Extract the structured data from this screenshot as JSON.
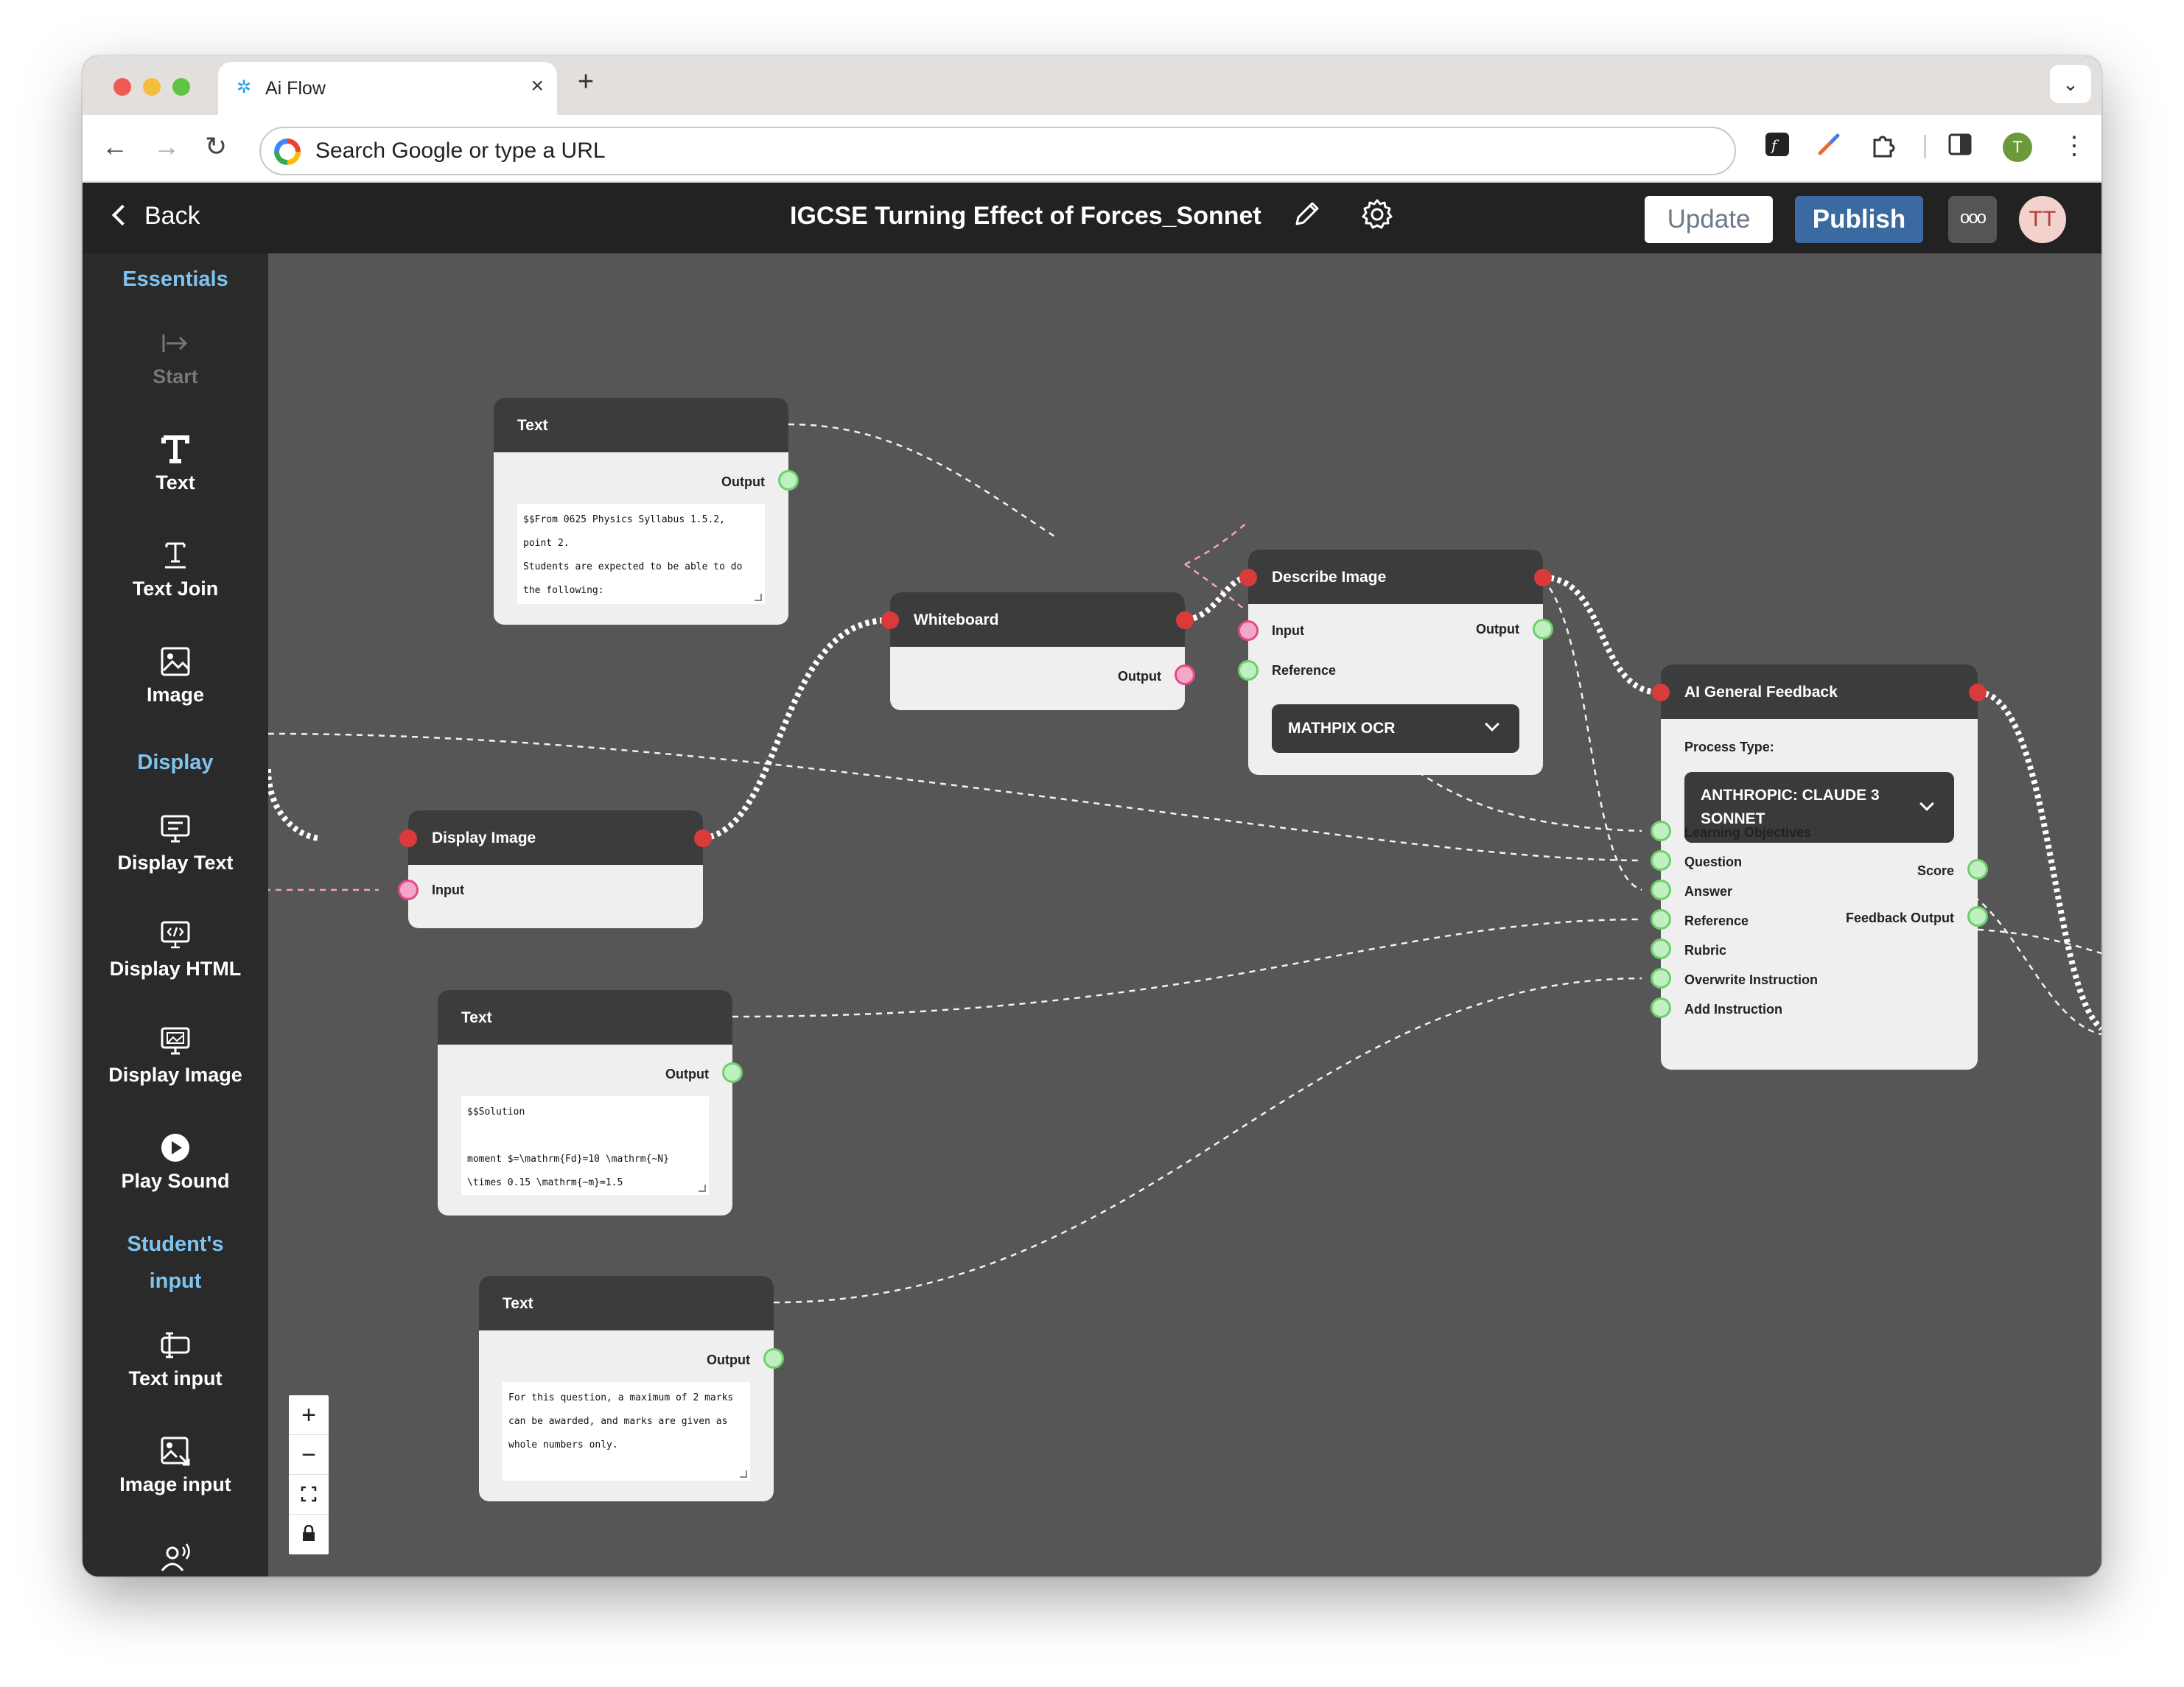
{
  "browser": {
    "tab_title": "Ai Flow",
    "omnibox_placeholder": "Search Google or type a URL",
    "profile_initial": "T",
    "traffic_colors": [
      "#ee5b55",
      "#f5bd3c",
      "#5fc443"
    ]
  },
  "header": {
    "back_label": "Back",
    "title": "IGCSE Turning Effect of Forces_Sonnet",
    "update_label": "Update",
    "publish_label": "Publish",
    "more_label": "ooo",
    "avatar_initials": "TT",
    "accent_color": "#3b6aa0"
  },
  "sidebar": {
    "sections": {
      "essentials": "Essentials",
      "display": "Display",
      "students_input_line1": "Student's",
      "students_input_line2": "input"
    },
    "items": {
      "start": "Start",
      "text": "Text",
      "text_join": "Text Join",
      "image": "Image",
      "display_text": "Display Text",
      "display_html": "Display HTML",
      "display_image": "Display Image",
      "play_sound": "Play Sound",
      "text_input": "Text input",
      "image_input": "Image input"
    },
    "section_color": "#7fc3f0"
  },
  "nodes": {
    "text1": {
      "title": "Text",
      "output_label": "Output",
      "content": "$$From 0625 Physics Syllabus 1.5.2,\npoint 2.\nStudents are expected to be able to do\nthe following:"
    },
    "whiteboard": {
      "title": "Whiteboard",
      "output_label": "Output"
    },
    "describe_image": {
      "title": "Describe Image",
      "input_label": "Input",
      "output_label": "Output",
      "reference_label": "Reference",
      "dropdown_value": "MATHPIX OCR"
    },
    "display_image": {
      "title": "Display Image",
      "input_label": "Input"
    },
    "ai_feedback": {
      "title": "AI General Feedback",
      "process_type_label": "Process Type:",
      "dropdown_line1": "ANTHROPIC: CLAUDE 3",
      "dropdown_line2": "SONNET",
      "inputs": {
        "learning_objectives": "Learning Objectives",
        "question": "Question",
        "answer": "Answer",
        "reference": "Reference",
        "rubric": "Rubric",
        "overwrite_instruction": "Overwrite Instruction",
        "add_instruction": "Add Instruction"
      },
      "outputs": {
        "score": "Score",
        "feedback_output": "Feedback Output"
      }
    },
    "text2": {
      "title": "Text",
      "output_label": "Output",
      "content": "$$Solution\n\nmoment $=\\mathrm{Fd}=10 \\mathrm{~N}\n\\times 0.15 \\mathrm{~m}=1.5"
    },
    "text3": {
      "title": "Text",
      "output_label": "Output",
      "content": "For this question, a maximum of 2 marks\ncan be awarded, and marks are given as\nwhole numbers only."
    }
  },
  "zoom_controls": {
    "zoom_in": "+",
    "zoom_out": "−"
  }
}
